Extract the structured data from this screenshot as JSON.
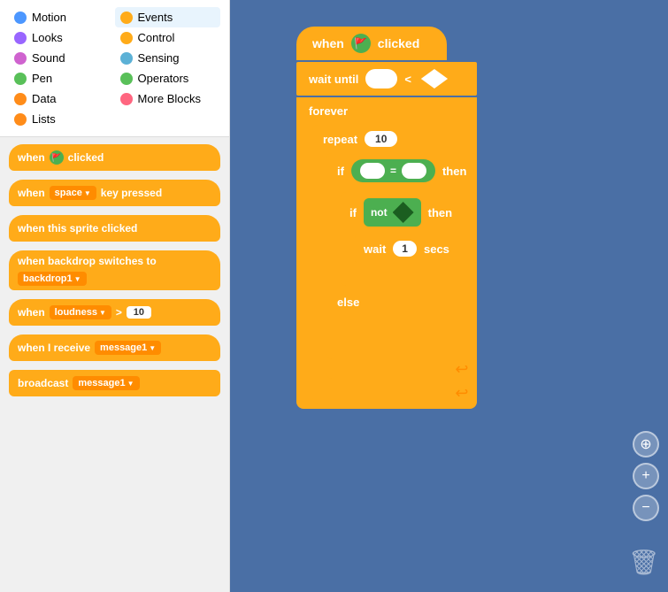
{
  "categories": {
    "left": [
      {
        "label": "Motion",
        "color": "#4C97FF",
        "active": false
      },
      {
        "label": "Looks",
        "color": "#9966FF",
        "active": false
      },
      {
        "label": "Sound",
        "color": "#CF63CF",
        "active": false
      },
      {
        "label": "Pen",
        "color": "#59C059",
        "active": false
      },
      {
        "label": "Data",
        "color": "#FF8C1A",
        "active": false
      },
      {
        "label": "Lists",
        "color": "#FF8C1A",
        "active": false
      }
    ],
    "right": [
      {
        "label": "Events",
        "color": "#FFAB19",
        "active": true
      },
      {
        "label": "Control",
        "color": "#FFAB19",
        "active": false
      },
      {
        "label": "Sensing",
        "color": "#5CB1D6",
        "active": false
      },
      {
        "label": "Operators",
        "color": "#59C059",
        "active": false
      },
      {
        "label": "More Blocks",
        "color": "#FF6680",
        "active": false
      }
    ]
  },
  "blocks": [
    {
      "id": "when-clicked",
      "type": "hat",
      "text": "when",
      "extra": "flag",
      "after": "clicked"
    },
    {
      "id": "when-key-pressed",
      "type": "hat",
      "text": "when",
      "dropdown": "space",
      "after": "key pressed"
    },
    {
      "id": "when-sprite-clicked",
      "type": "hat",
      "text": "when this sprite clicked"
    },
    {
      "id": "when-backdrop",
      "type": "hat",
      "text": "when backdrop switches to",
      "dropdown2": "backdrop1"
    },
    {
      "id": "when-loudness",
      "type": "hat",
      "text": "when",
      "dropdown": "loudness",
      "op": ">",
      "value": "10"
    },
    {
      "id": "when-receive",
      "type": "hat",
      "text": "when I receive",
      "dropdown": "message1"
    },
    {
      "id": "broadcast",
      "type": "stack",
      "text": "broadcast",
      "dropdown": "message1"
    }
  ],
  "canvas": {
    "blocks": {
      "when_clicked": "when",
      "flag_label": "🚩",
      "clicked_label": "clicked",
      "wait_until": "wait until",
      "less_than": "<",
      "forever": "forever",
      "repeat": "repeat",
      "repeat_val": "10",
      "if_label": "if",
      "equals": "=",
      "then_label": "then",
      "if2_label": "if",
      "not_label": "not",
      "then2_label": "then",
      "wait_label": "wait",
      "wait_val": "1",
      "secs_label": "secs",
      "else_label": "else"
    }
  },
  "controls": {
    "crosshair": "⊕",
    "plus": "+",
    "minus": "−",
    "trash": "🗑"
  }
}
